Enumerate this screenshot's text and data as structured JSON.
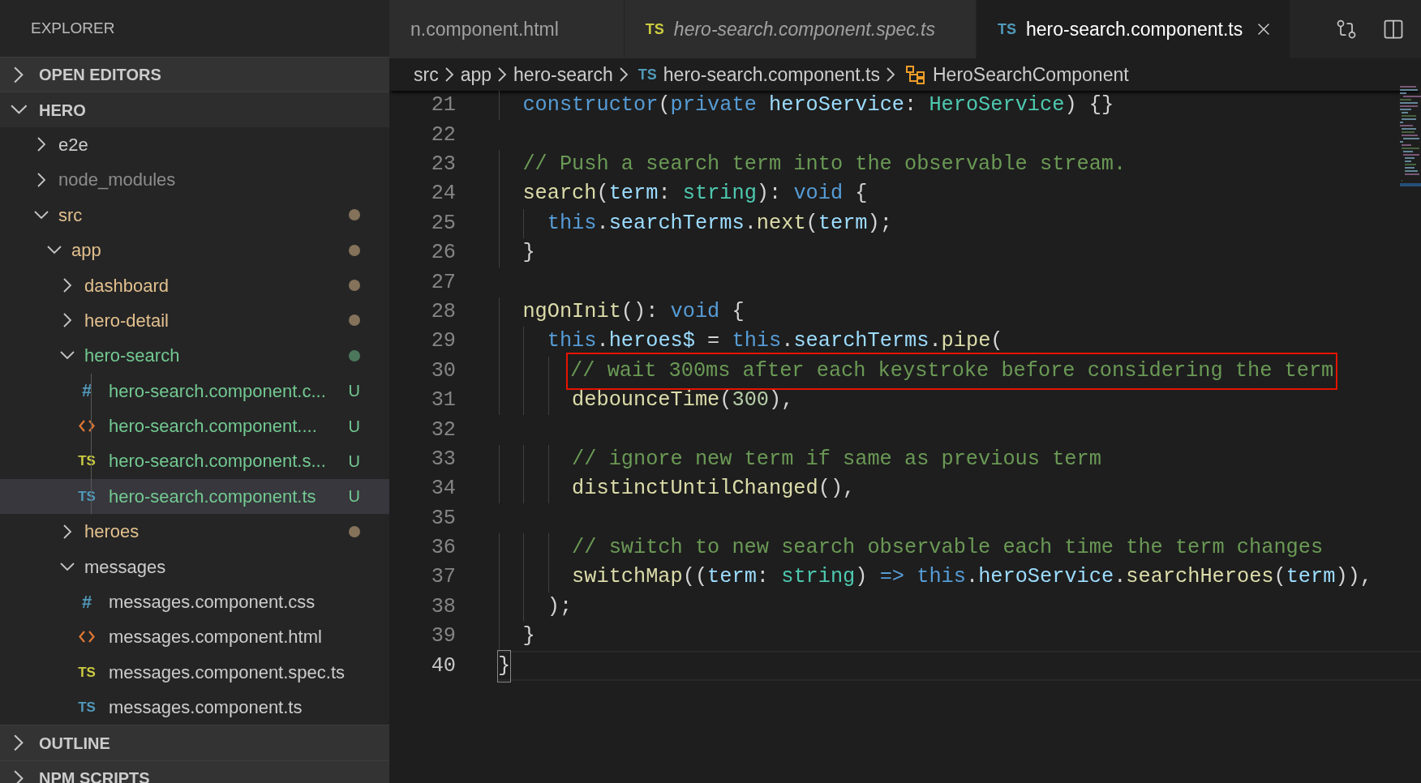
{
  "sidebar": {
    "title": "EXPLORER",
    "sections": [
      {
        "title": "OPEN EDITORS",
        "expanded": false
      },
      {
        "title": "HERO",
        "expanded": true,
        "tree": [
          {
            "label": "e2e",
            "kind": "folder",
            "expanded": false,
            "color": "#cccccc",
            "dot": false
          },
          {
            "label": "node_modules",
            "kind": "folder",
            "expanded": false,
            "color": "#8c8c8c",
            "dot": false
          },
          {
            "label": "src",
            "kind": "folder",
            "expanded": true,
            "color": "#e2c08d",
            "dot": true,
            "children": [
              {
                "label": "app",
                "kind": "folder",
                "expanded": true,
                "color": "#e2c08d",
                "dot": true,
                "children": [
                  {
                    "label": "dashboard",
                    "kind": "folder",
                    "expanded": false,
                    "color": "#e2c08d",
                    "dot": true
                  },
                  {
                    "label": "hero-detail",
                    "kind": "folder",
                    "expanded": false,
                    "color": "#e2c08d",
                    "dot": true
                  },
                  {
                    "label": "hero-search",
                    "kind": "folder",
                    "expanded": true,
                    "color": "#73c991",
                    "dot": true,
                    "children": [
                      {
                        "label": "hero-search.component.c...",
                        "kind": "css",
                        "icon_text": "#",
                        "color": "#73c991",
                        "badge": "U",
                        "selected": false
                      },
                      {
                        "label": "hero-search.component....",
                        "kind": "html",
                        "color": "#73c991",
                        "badge": "U",
                        "selected": false
                      },
                      {
                        "label": "hero-search.component.s...",
                        "kind": "spec",
                        "icon_text": "TS",
                        "color": "#73c991",
                        "badge": "U",
                        "selected": false
                      },
                      {
                        "label": "hero-search.component.ts",
                        "kind": "ts",
                        "icon_text": "TS",
                        "color": "#73c991",
                        "badge": "U",
                        "selected": true
                      }
                    ]
                  },
                  {
                    "label": "heroes",
                    "kind": "folder",
                    "expanded": false,
                    "color": "#e2c08d",
                    "dot": true
                  },
                  {
                    "label": "messages",
                    "kind": "folder",
                    "expanded": true,
                    "color": "#cccccc",
                    "dot": false,
                    "children": [
                      {
                        "label": "messages.component.css",
                        "kind": "css",
                        "icon_text": "#",
                        "color": "#cccccc",
                        "selected": false
                      },
                      {
                        "label": "messages.component.html",
                        "kind": "html",
                        "color": "#cccccc",
                        "selected": false
                      },
                      {
                        "label": "messages.component.spec.ts",
                        "kind": "spec",
                        "icon_text": "TS",
                        "color": "#cccccc",
                        "selected": false
                      },
                      {
                        "label": "messages.component.ts",
                        "kind": "ts",
                        "icon_text": "TS",
                        "color": "#cccccc",
                        "selected": false
                      }
                    ]
                  }
                ]
              }
            ]
          }
        ]
      },
      {
        "title": "OUTLINE",
        "expanded": false
      },
      {
        "title": "NPM SCRIPTS",
        "expanded": false
      }
    ]
  },
  "tabs": [
    {
      "label": "n.component.html",
      "selected": false,
      "italic": false
    },
    {
      "label": "hero-search.component.spec.ts",
      "icon_text": "TS",
      "kind": "spec",
      "selected": false,
      "italic": true
    },
    {
      "label": "hero-search.component.ts",
      "icon_text": "TS",
      "kind": "ts",
      "selected": true,
      "italic": false
    }
  ],
  "breadcrumb": [
    {
      "label": "src",
      "kind": "folder"
    },
    {
      "label": "app",
      "kind": "folder"
    },
    {
      "label": "hero-search",
      "kind": "folder"
    },
    {
      "label": "hero-search.component.ts",
      "kind": "file",
      "icon_text": "TS"
    },
    {
      "label": "HeroSearchComponent",
      "kind": "class"
    }
  ],
  "code": {
    "lines": [
      {
        "number": "21",
        "tokens": [
          {
            "kind": "keyword",
            "text": "  constructor"
          },
          {
            "kind": "plain",
            "text": "("
          },
          {
            "kind": "keyword",
            "text": "private "
          },
          {
            "kind": "variable",
            "text": "heroService"
          },
          {
            "kind": "plain",
            "text": ": "
          },
          {
            "kind": "type",
            "text": "HeroService"
          },
          {
            "kind": "plain",
            "text": ") {}"
          }
        ]
      },
      {
        "number": "22"
      },
      {
        "number": "23",
        "tokens": [
          {
            "kind": "comment",
            "text": "  // Push a search term into the observable stream."
          }
        ]
      },
      {
        "number": "24",
        "tokens": [
          {
            "kind": "function",
            "text": "  search"
          },
          {
            "kind": "plain",
            "text": "("
          },
          {
            "kind": "variable",
            "text": "term"
          },
          {
            "kind": "plain",
            "text": ": "
          },
          {
            "kind": "type",
            "text": "string"
          },
          {
            "kind": "plain",
            "text": "): "
          },
          {
            "kind": "keyword",
            "text": "void"
          },
          {
            "kind": "plain",
            "text": " {"
          }
        ]
      },
      {
        "number": "25",
        "tokens": [
          {
            "kind": "keyword",
            "text": "    this"
          },
          {
            "kind": "plain",
            "text": "."
          },
          {
            "kind": "variable",
            "text": "searchTerms"
          },
          {
            "kind": "plain",
            "text": "."
          },
          {
            "kind": "function",
            "text": "next"
          },
          {
            "kind": "plain",
            "text": "("
          },
          {
            "kind": "variable",
            "text": "term"
          },
          {
            "kind": "plain",
            "text": ");"
          }
        ]
      },
      {
        "number": "26",
        "tokens": [
          {
            "kind": "plain",
            "text": "  }"
          }
        ]
      },
      {
        "number": "27"
      },
      {
        "number": "28",
        "tokens": [
          {
            "kind": "function",
            "text": "  ngOnInit"
          },
          {
            "kind": "plain",
            "text": "(): "
          },
          {
            "kind": "keyword",
            "text": "void"
          },
          {
            "kind": "plain",
            "text": " {"
          }
        ]
      },
      {
        "number": "29",
        "tokens": [
          {
            "kind": "keyword",
            "text": "    this"
          },
          {
            "kind": "plain",
            "text": "."
          },
          {
            "kind": "variable",
            "text": "heroes$"
          },
          {
            "kind": "plain",
            "text": " = "
          },
          {
            "kind": "keyword",
            "text": "this"
          },
          {
            "kind": "plain",
            "text": "."
          },
          {
            "kind": "variable",
            "text": "searchTerms"
          },
          {
            "kind": "plain",
            "text": "."
          },
          {
            "kind": "function",
            "text": "pipe"
          },
          {
            "kind": "plain",
            "text": "("
          }
        ]
      },
      {
        "number": "30",
        "tokens": [
          {
            "kind": "comment",
            "text": "      // wait 300ms after each keystroke before considering the term",
            "boxed": true
          }
        ]
      },
      {
        "number": "31",
        "tokens": [
          {
            "kind": "function",
            "text": "      debounceTime"
          },
          {
            "kind": "plain",
            "text": "("
          },
          {
            "kind": "number",
            "text": "300"
          },
          {
            "kind": "plain",
            "text": "),"
          }
        ]
      },
      {
        "number": "32"
      },
      {
        "number": "33",
        "tokens": [
          {
            "kind": "comment",
            "text": "      // ignore new term if same as previous term"
          }
        ]
      },
      {
        "number": "34",
        "tokens": [
          {
            "kind": "function",
            "text": "      distinctUntilChanged"
          },
          {
            "kind": "plain",
            "text": "(),"
          }
        ]
      },
      {
        "number": "35"
      },
      {
        "number": "36",
        "tokens": [
          {
            "kind": "comment",
            "text": "      // switch to new search observable each time the term changes"
          }
        ]
      },
      {
        "number": "37",
        "tokens": [
          {
            "kind": "function",
            "text": "      switchMap"
          },
          {
            "kind": "plain",
            "text": "(("
          },
          {
            "kind": "variable",
            "text": "term"
          },
          {
            "kind": "plain",
            "text": ": "
          },
          {
            "kind": "type",
            "text": "string"
          },
          {
            "kind": "plain",
            "text": ") "
          },
          {
            "kind": "keyword",
            "text": "=> this"
          },
          {
            "kind": "plain",
            "text": "."
          },
          {
            "kind": "variable",
            "text": "heroService"
          },
          {
            "kind": "plain",
            "text": "."
          },
          {
            "kind": "function",
            "text": "searchHeroes"
          },
          {
            "kind": "plain",
            "text": "("
          },
          {
            "kind": "variable",
            "text": "term"
          },
          {
            "kind": "plain",
            "text": ")),"
          }
        ]
      },
      {
        "number": "38",
        "tokens": [
          {
            "kind": "plain",
            "text": "    );"
          }
        ]
      },
      {
        "number": "39",
        "tokens": [
          {
            "kind": "plain",
            "text": "  }"
          }
        ]
      },
      {
        "number": "40",
        "current": true,
        "tokens": [
          {
            "kind": "bracket",
            "text": "}"
          }
        ]
      }
    ]
  }
}
